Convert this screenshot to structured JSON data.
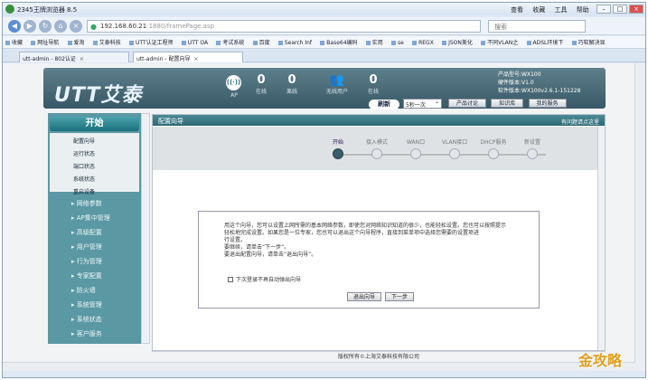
{
  "browser": {
    "title": "2345王牌浏览器 8.5",
    "url": "192.168.60.21",
    "url_rest": ":1880/framePage.asp",
    "search_placeholder": "搜索",
    "menu": [
      "查看",
      "收藏",
      "工具",
      "帮助"
    ],
    "favorites": [
      "收藏",
      "网址导航",
      "爱淘",
      "艾泰科技",
      "UTT认证工程师",
      "UTT OA",
      "考试系统",
      "百度",
      "Search Inf",
      "Base64编码",
      "实用",
      "se",
      "REGX",
      "JSON美化",
      "不同VLAN之",
      "ADSL环境下",
      "巧软解决显"
    ],
    "tabs": [
      {
        "label": "utt-admin - 802认证",
        "active": false
      },
      {
        "label": "utt-admin - 配置向导",
        "active": true
      }
    ]
  },
  "header": {
    "brand": "UTT艾泰",
    "ap_label": "AP",
    "stats": [
      {
        "num": "0",
        "label": "在线"
      },
      {
        "num": "0",
        "label": "离线"
      },
      {
        "num": "",
        "label": "无线用户"
      },
      {
        "num": "0",
        "label": "在线"
      }
    ],
    "product_model": "产品型号:WX100",
    "hardware_version": "硬件版本:V1.0",
    "software_version": "软件版本:WX100v2.6.1-151228",
    "refresh_label": "刷新",
    "refresh_interval": "5秒一次",
    "buttons": [
      "产品讨论",
      "知识库",
      "我的服务"
    ]
  },
  "sidebar": {
    "open_label": "开始",
    "sub_items": [
      "配置向导",
      "运行状态",
      "端口状态",
      "系统状态",
      "重启设备"
    ],
    "groups": [
      "网络参数",
      "AP集中管理",
      "高级配置",
      "用户管理",
      "行为管理",
      "专家配置",
      "防火墙",
      "系统管理",
      "系统状态",
      "客户服务"
    ]
  },
  "main": {
    "title": "配置向导",
    "title_right": "有问题请点这里",
    "steps": [
      "开始",
      "接入模式",
      "WAN口",
      "VLAN接口",
      "DHCP服务",
      "新设置"
    ],
    "message_lines": [
      "用这个向导，您可以设置上网所需的基本网络参数，即使您对网络知识知道的很少，也能轻松设置。您也可以按照提示",
      "轻松地完成设置。如果您是一位专家，您也可以退出这个向导程序，直接到菜单项中选择您需要的设置项进",
      "行设置。",
      "要继续，请单击“下一步”。",
      "要退出配置向导，请单击“退出向导”。"
    ],
    "checkbox_label": "下次登录不再自动弹出向导",
    "exit_button": "退出向导",
    "next_button": "下一步"
  },
  "footer": "版权所有©上海艾泰科技有限公司",
  "watermark": "金攻略"
}
